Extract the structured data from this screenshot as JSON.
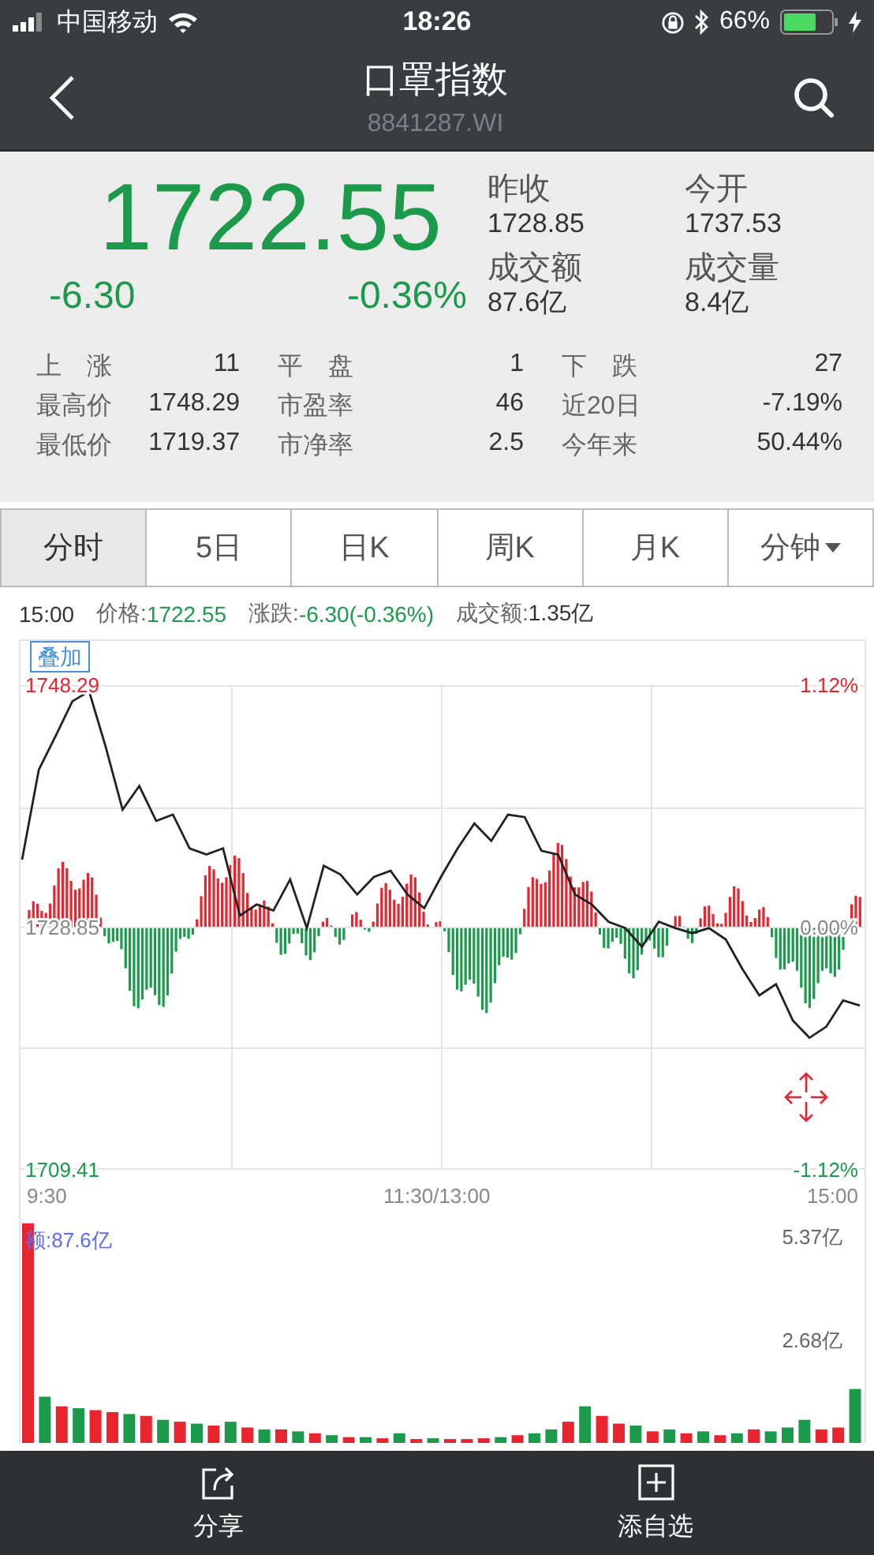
{
  "status_bar": {
    "carrier": "中国移动",
    "time": "18:26",
    "battery": "66%"
  },
  "nav": {
    "title": "口罩指数",
    "code": "8841287.WI"
  },
  "quote": {
    "price": "1722.55",
    "change": "-6.30",
    "change_pct": "-0.36%",
    "color": "#1a9a4a",
    "fields": [
      {
        "label": "昨收",
        "value": "1728.85"
      },
      {
        "label": "今开",
        "value": "1737.53"
      },
      {
        "label": "成交额",
        "value": "87.6亿"
      },
      {
        "label": "成交量",
        "value": "8.4亿"
      }
    ],
    "stats": [
      {
        "label": "上　涨",
        "value": "11"
      },
      {
        "label": "平　盘",
        "value": "1"
      },
      {
        "label": "下　跌",
        "value": "27"
      },
      {
        "label": "最高价",
        "value": "1748.29"
      },
      {
        "label": "市盈率",
        "value": "46"
      },
      {
        "label": "近20日",
        "value": "-7.19%"
      },
      {
        "label": "最低价",
        "value": "1719.37"
      },
      {
        "label": "市净率",
        "value": "2.5"
      },
      {
        "label": "今年来",
        "value": "50.44%"
      }
    ]
  },
  "tabs": [
    {
      "label": "分时",
      "selected": true,
      "dropdown": false
    },
    {
      "label": "5日",
      "selected": false,
      "dropdown": false
    },
    {
      "label": "日K",
      "selected": false,
      "dropdown": false
    },
    {
      "label": "周K",
      "selected": false,
      "dropdown": false
    },
    {
      "label": "月K",
      "selected": false,
      "dropdown": false
    },
    {
      "label": "分钟",
      "selected": false,
      "dropdown": true
    }
  ],
  "info": {
    "time": "15:00",
    "items": [
      {
        "label": "价格:",
        "value": "1722.55",
        "color": "#1a9a4a"
      },
      {
        "label": "涨跌:",
        "value": "-6.30(-0.36%)",
        "color": "#1a9a4a"
      },
      {
        "label": "成交额:",
        "value": "1.35亿",
        "color": "#333333"
      }
    ]
  },
  "price_chart": {
    "overlay_button": "叠加",
    "right_ticks": [
      {
        "label": "1.12%",
        "color": "#e8242f"
      },
      {
        "label": "0.00%",
        "color": "#888888"
      },
      {
        "label": "-1.12%",
        "color": "#1a9a4a"
      }
    ],
    "time_labels": [
      "9:30",
      "11:30/13:00",
      "15:00"
    ],
    "chart_data": {
      "type": "line",
      "ylim": [
        1709.41,
        1748.29
      ],
      "yticks": [
        {
          "value": 1709.41,
          "label": "1709.41"
        },
        {
          "value": 1728.85,
          "label": "1728.85"
        },
        {
          "value": 1748.29,
          "label": "1748.29"
        }
      ],
      "series": [
        {
          "color": "#222222",
          "values": [
            1734.3,
            1741.5,
            1744.2,
            1747.0,
            1747.8,
            1743.3,
            1738.3,
            1740.2,
            1737.4,
            1737.9,
            1735.2,
            1734.7,
            1735.2,
            1729.8,
            1730.7,
            1730.2,
            1732.7,
            1728.8,
            1733.8,
            1733.1,
            1731.5,
            1732.9,
            1733.4,
            1731.5,
            1730.4,
            1732.9,
            1735.2,
            1737.2,
            1735.8,
            1737.9,
            1737.7,
            1735.0,
            1734.7,
            1731.5,
            1730.7,
            1729.3,
            1728.8,
            1727.3,
            1729.3,
            1728.8,
            1728.4,
            1728.8,
            1727.9,
            1725.5,
            1723.4,
            1724.3,
            1721.4,
            1720.0,
            1720.9,
            1723.0,
            1722.6
          ]
        }
      ]
    }
  },
  "volume_chart": {
    "label": "额:87.6亿",
    "chart_data": {
      "type": "bar",
      "stacked": true,
      "ylim": [
        0,
        5.9
      ],
      "categories": [
        null,
        null,
        null,
        null,
        null,
        null,
        null,
        null,
        null,
        null,
        null,
        null,
        null,
        null,
        null,
        null,
        null,
        null,
        null,
        null,
        null,
        null,
        null,
        null,
        null,
        null,
        null,
        null,
        null,
        null,
        null,
        null,
        null,
        null,
        null,
        null,
        null,
        null,
        null,
        null,
        null,
        null,
        null,
        null,
        null,
        null,
        null,
        null,
        null,
        null
      ],
      "yticks": [
        {
          "value": 2.68,
          "label": "2.68亿"
        },
        {
          "value": 5.37,
          "label": "5.37亿"
        }
      ],
      "series": [
        {
          "color": "#e8242f",
          "values": [
            5.7,
            null,
            0.95,
            null,
            0.85,
            0.8,
            null,
            0.7,
            null,
            0.55,
            null,
            0.45,
            null,
            0.4,
            null,
            0.35,
            null,
            0.25,
            null,
            0.15,
            null,
            0.12,
            null,
            0.1,
            null,
            0.1,
            0.1,
            0.12,
            null,
            0.2,
            null,
            null,
            0.55,
            null,
            0.7,
            0.5,
            null,
            0.3,
            null,
            0.25,
            null,
            0.2,
            null,
            0.35,
            null,
            null,
            null,
            0.35,
            0.4,
            null
          ]
        },
        {
          "color": "#1a9a4a",
          "values": [
            null,
            1.2,
            null,
            0.9,
            null,
            null,
            0.75,
            null,
            0.6,
            null,
            0.5,
            null,
            0.55,
            null,
            0.35,
            null,
            0.3,
            null,
            0.2,
            null,
            0.15,
            null,
            0.25,
            null,
            0.12,
            null,
            null,
            null,
            0.15,
            null,
            0.25,
            0.35,
            null,
            0.95,
            null,
            null,
            0.45,
            null,
            0.35,
            null,
            0.3,
            null,
            0.25,
            null,
            0.3,
            0.4,
            0.6,
            null,
            null,
            1.4
          ]
        }
      ]
    }
  },
  "bottom_bar": [
    {
      "label": "分享",
      "kind": "share"
    },
    {
      "label": "添自选",
      "kind": "add"
    }
  ]
}
